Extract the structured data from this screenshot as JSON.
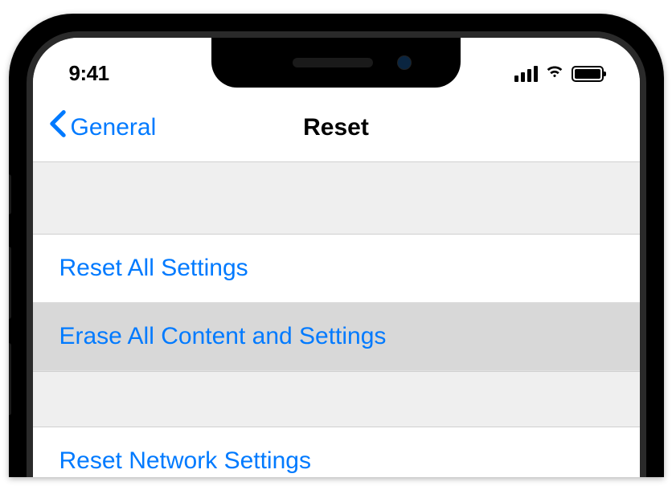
{
  "status": {
    "time": "9:41"
  },
  "nav": {
    "back_label": "General",
    "title": "Reset"
  },
  "menu": {
    "items": [
      {
        "label": "Reset All Settings",
        "selected": false
      },
      {
        "label": "Erase All Content and Settings",
        "selected": true
      },
      {
        "label": "Reset Network Settings",
        "selected": false
      }
    ]
  }
}
